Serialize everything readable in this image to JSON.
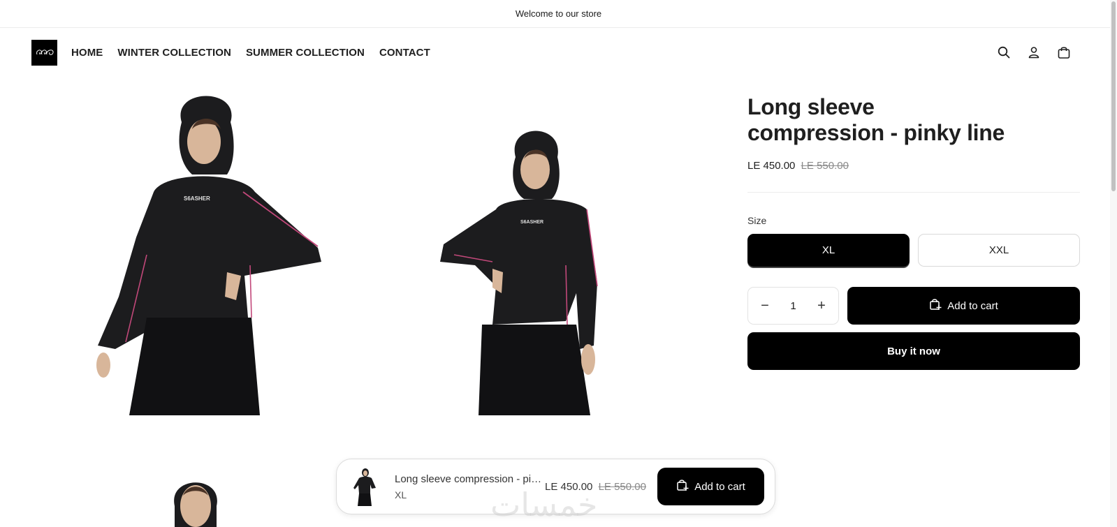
{
  "announcement": {
    "text": "Welcome to our store"
  },
  "header": {
    "logo_alt": "store-logo",
    "nav": [
      "HOME",
      "WINTER COLLECTION",
      "SUMMER COLLECTION",
      "CONTACT"
    ],
    "icons": [
      "search-icon",
      "account-icon",
      "cart-icon"
    ]
  },
  "gallery": {
    "print_text": "S6ASHER"
  },
  "product": {
    "title_line1": "Long sleeve",
    "title_line2": "compression - pinky line",
    "price": "LE 450.00",
    "compare_price": "LE 550.00",
    "size_label": "Size",
    "sizes": [
      "XL",
      "XXL"
    ],
    "selected_size": "XL",
    "quantity": "1",
    "qty_minus": "−",
    "qty_plus": "+",
    "add_to_cart": "Add to cart",
    "buy_now": "Buy it now"
  },
  "sticky": {
    "title": "Long sleeve compression - pinky line",
    "variant": "XL",
    "price": "LE 450.00",
    "compare_price": "LE 550.00",
    "add_to_cart": "Add to cart"
  },
  "watermark": {
    "text": "خمسات"
  },
  "colors": {
    "accent": "#000000",
    "text": "#1f1f1f",
    "muted": "#8a8a8a",
    "border": "#d9d9d9"
  }
}
